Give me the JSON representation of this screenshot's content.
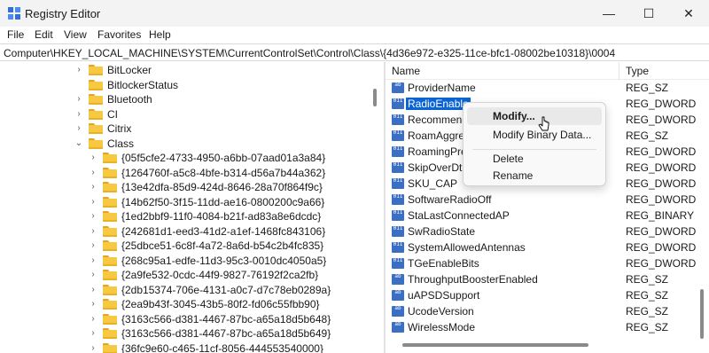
{
  "window": {
    "title": "Registry Editor",
    "minimize_glyph": "—",
    "maximize_glyph": "☐",
    "close_glyph": "✕"
  },
  "menu": [
    "File",
    "Edit",
    "View",
    "Favorites",
    "Help"
  ],
  "address": "Computer\\HKEY_LOCAL_MACHINE\\SYSTEM\\CurrentControlSet\\Control\\Class\\{4d36e972-e325-11ce-bfc1-08002be10318}\\0004",
  "tree": [
    {
      "label": "BitLocker",
      "chevron": "›"
    },
    {
      "label": "BitlockerStatus",
      "chevron": ""
    },
    {
      "label": "Bluetooth",
      "chevron": "›"
    },
    {
      "label": "CI",
      "chevron": "›"
    },
    {
      "label": "Citrix",
      "chevron": "›"
    },
    {
      "label": "Class",
      "chevron": "⌄"
    },
    {
      "label": "{05f5cfe2-4733-4950-a6bb-07aad01a3a84}",
      "chevron": "›"
    },
    {
      "label": "{1264760f-a5c8-4bfe-b314-d56a7b44a362}",
      "chevron": "›"
    },
    {
      "label": "{13e42dfa-85d9-424d-8646-28a70f864f9c}",
      "chevron": "›"
    },
    {
      "label": "{14b62f50-3f15-11dd-ae16-0800200c9a66}",
      "chevron": "›"
    },
    {
      "label": "{1ed2bbf9-11f0-4084-b21f-ad83a8e6dcdc}",
      "chevron": "›"
    },
    {
      "label": "{242681d1-eed3-41d2-a1ef-1468fc843106}",
      "chevron": "›"
    },
    {
      "label": "{25dbce51-6c8f-4a72-8a6d-b54c2b4fc835}",
      "chevron": "›"
    },
    {
      "label": "{268c95a1-edfe-11d3-95c3-0010dc4050a5}",
      "chevron": "›"
    },
    {
      "label": "{2a9fe532-0cdc-44f9-9827-76192f2ca2fb}",
      "chevron": "›"
    },
    {
      "label": "{2db15374-706e-4131-a0c7-d7c78eb0289a}",
      "chevron": "›"
    },
    {
      "label": "{2ea9b43f-3045-43b5-80f2-fd06c55fbb90}",
      "chevron": "›"
    },
    {
      "label": "{3163c566-d381-4467-87bc-a65a18d5b648}",
      "chevron": "›"
    },
    {
      "label": "{3163c566-d381-4467-87bc-a65a18d5b649}",
      "chevron": "›"
    },
    {
      "label": "{36fc9e60-c465-11cf-8056-444553540000}",
      "chevron": "›"
    }
  ],
  "list": {
    "col_name": "Name",
    "col_type": "Type",
    "rows": [
      {
        "name": "ProviderName",
        "type": "REG_SZ",
        "icon": "ab"
      },
      {
        "name": "RadioEnable",
        "type": "REG_DWORD",
        "icon": "011"
      },
      {
        "name": "Recommend",
        "type": "REG_DWORD",
        "icon": "011"
      },
      {
        "name": "RoamAggres",
        "type": "REG_SZ",
        "icon": "011"
      },
      {
        "name": "RoamingPref",
        "type": "REG_DWORD",
        "icon": "011"
      },
      {
        "name": "SkipOverDtin",
        "type": "REG_DWORD",
        "icon": "011"
      },
      {
        "name": "SKU_CAP",
        "type": "REG_DWORD",
        "icon": "011"
      },
      {
        "name": "SoftwareRadioOff",
        "type": "REG_DWORD",
        "icon": "011"
      },
      {
        "name": "StaLastConnectedAP",
        "type": "REG_BINARY",
        "icon": "011"
      },
      {
        "name": "SwRadioState",
        "type": "REG_DWORD",
        "icon": "011"
      },
      {
        "name": "SystemAllowedAntennas",
        "type": "REG_DWORD",
        "icon": "011"
      },
      {
        "name": "TGeEnableBits",
        "type": "REG_DWORD",
        "icon": "011"
      },
      {
        "name": "ThroughputBoosterEnabled",
        "type": "REG_SZ",
        "icon": "ab"
      },
      {
        "name": "uAPSDSupport",
        "type": "REG_SZ",
        "icon": "ab"
      },
      {
        "name": "UcodeVersion",
        "type": "REG_SZ",
        "icon": "ab"
      },
      {
        "name": "WirelessMode",
        "type": "REG_SZ",
        "icon": "ab"
      }
    ]
  },
  "context_menu": {
    "modify": "Modify...",
    "modify_binary": "Modify Binary Data...",
    "delete": "Delete",
    "rename": "Rename"
  },
  "colors": {
    "selection": "#0a64d3",
    "folder": "#f7c842",
    "value_icon": "#3b6fc4"
  }
}
